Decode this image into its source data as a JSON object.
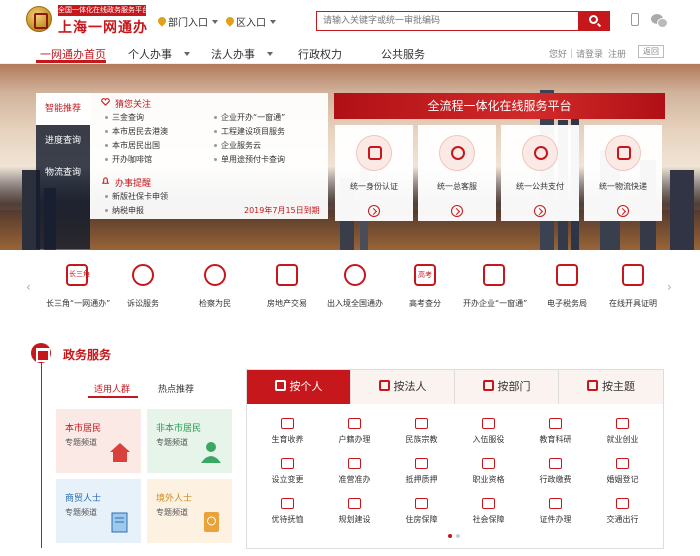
{
  "header": {
    "logo_tagline": "全国一体化在线政务服务平台",
    "logo_name": "上海一网通办",
    "department_selector": "部门入口",
    "district_selector": "区入口",
    "search_placeholder": "请输入关键字或统一审批编码"
  },
  "nav": {
    "items": [
      "一网通办首页",
      "个人办事",
      "法人办事",
      "行政权力",
      "公共服务"
    ],
    "greeting": "您好｜请登录",
    "register": "注册",
    "back": "返回"
  },
  "hero": {
    "sidebar": [
      "智能推荐",
      "进度查询",
      "物流查询"
    ],
    "guess_heading": "猜您关注",
    "guess_links": [
      "三金查询",
      "企业开办“一窗通”",
      "本市居民去港澳",
      "工程建设项目服务",
      "本市居民出国",
      "企业服务云",
      "开办咖啡馆",
      "单用途预付卡查询"
    ],
    "reminder_heading": "办事提醒",
    "reminder_links": [
      "新版社保卡申领",
      "纳税申报"
    ],
    "reminder_date": "2019年7月15日到期",
    "banner": "全流程一体化在线服务平台",
    "service_cards": [
      "统一身份认证",
      "统一总客服",
      "统一公共支付",
      "统一物流快递"
    ]
  },
  "quick_strip": {
    "items": [
      "长三角“一网通办”",
      "诉讼服务",
      "检察为民",
      "房地产交易",
      "出入境全国通办",
      "高考查分",
      "开办企业“一窗通”",
      "电子税务局",
      "在线开具证明"
    ],
    "icon_text": [
      "长三角",
      "",
      "",
      "",
      "",
      "高考",
      "",
      "",
      ""
    ]
  },
  "section": {
    "title": "政务服务",
    "subtabs": [
      "适用人群",
      "热点推荐"
    ],
    "population_cards": [
      {
        "title": "本市居民",
        "sub": "专题频道"
      },
      {
        "title": "非本市居民",
        "sub": "专题频道"
      },
      {
        "title": "商贸人士",
        "sub": "专题频道"
      },
      {
        "title": "境外人士",
        "sub": "专题频道"
      }
    ],
    "tabs": [
      "按个人",
      "按法人",
      "按部门",
      "按主题"
    ],
    "services": [
      "生育收养",
      "户籍办理",
      "民族宗教",
      "入伍服役",
      "教育科研",
      "就业创业",
      "设立变更",
      "准营准办",
      "抵押质押",
      "职业资格",
      "行政缴费",
      "婚姻登记",
      "优待抚恤",
      "规划建设",
      "住房保障",
      "社会保障",
      "证件办理",
      "交通出行"
    ]
  },
  "colors": {
    "accent": "#c5171c",
    "dark_panel": "#1c2438"
  }
}
